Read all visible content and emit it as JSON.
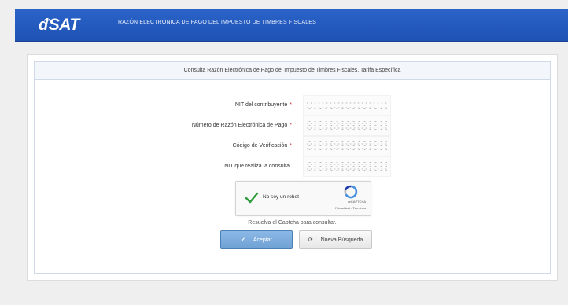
{
  "header": {
    "logo_text": "SAT",
    "title": "RAZÓN ELECTRÓNICA DE PAGO DEL IMPUESTO DE TIMBRES FISCALES"
  },
  "form": {
    "heading": "Consulta Razón Electrónica de Pago del Impuesto de Timbres Fiscales, Tarifa Específica",
    "fields": [
      {
        "label": "NIT del contribuyente",
        "required": "*",
        "value": ""
      },
      {
        "label": "Número de Razón Electrónica de Pago",
        "required": "*",
        "value": ""
      },
      {
        "label": "Código de Verificación",
        "required": "*",
        "value": ""
      },
      {
        "label": "NIT que realiza la consulta",
        "required": "",
        "value": ""
      }
    ]
  },
  "captcha": {
    "label": "No soy un robot",
    "brand": "reCAPTCHA",
    "links": "Privacidad - Términos"
  },
  "hint": "Resuelva el Captcha para consultar.",
  "buttons": {
    "accept": "Aceptar",
    "new_search": "Nueva Búsqueda"
  },
  "icons": {
    "checkmark": "check-icon",
    "refresh": "refresh-icon",
    "captcha_logo": "recaptcha-icon"
  }
}
